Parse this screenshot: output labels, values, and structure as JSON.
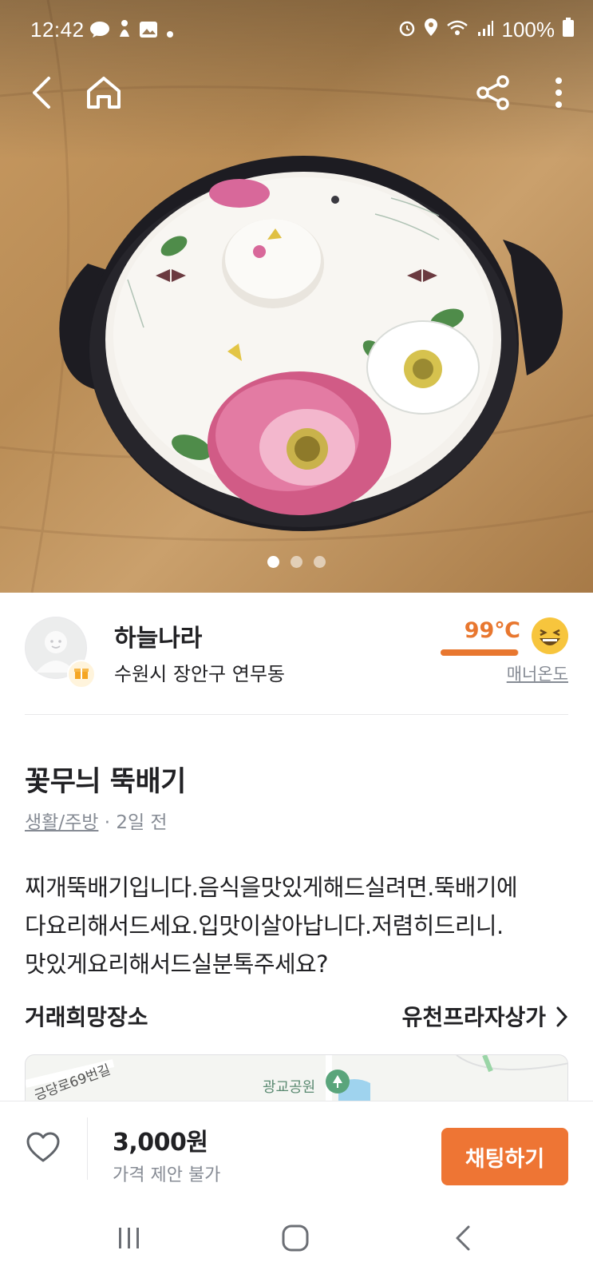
{
  "status_bar": {
    "time": "12:42",
    "battery": "100%"
  },
  "seller": {
    "name": "하늘나라",
    "location": "수원시 장안구 연무동",
    "temperature": "99℃",
    "temperature_fill": 0.99,
    "manner_label": "매너온도"
  },
  "product": {
    "title": "꽃무늬 뚝배기",
    "category": "생활/주방",
    "time_ago": "· 2일 전",
    "description_lines": [
      "찌개뚝배기입니다.음식을맛있게해드실려면.뚝배기에",
      "다요리해서드세요.입맛이살아납니다.저렴히드리니.",
      "맛있게요리해서드실분톡주세요?"
    ]
  },
  "trade_place": {
    "label": "거래희망장소",
    "value": "유천프라자상가"
  },
  "map": {
    "road_label": "긍당로69번길",
    "park_label": "광교공원"
  },
  "bottom": {
    "price": "3,000원",
    "price_note": "가격 제안 불가",
    "chat_button": "채팅하기"
  },
  "image_pager": {
    "count": 3,
    "active": 1
  },
  "colors": {
    "accent": "#ee7534",
    "temperature": "#e8772f",
    "text": "#212124",
    "muted": "#868b94"
  },
  "icons": {
    "back": "back-arrow-icon",
    "home": "home-icon",
    "share": "share-icon",
    "more": "more-vertical-icon",
    "like": "heart-icon",
    "chevron": "chevron-right-icon"
  }
}
